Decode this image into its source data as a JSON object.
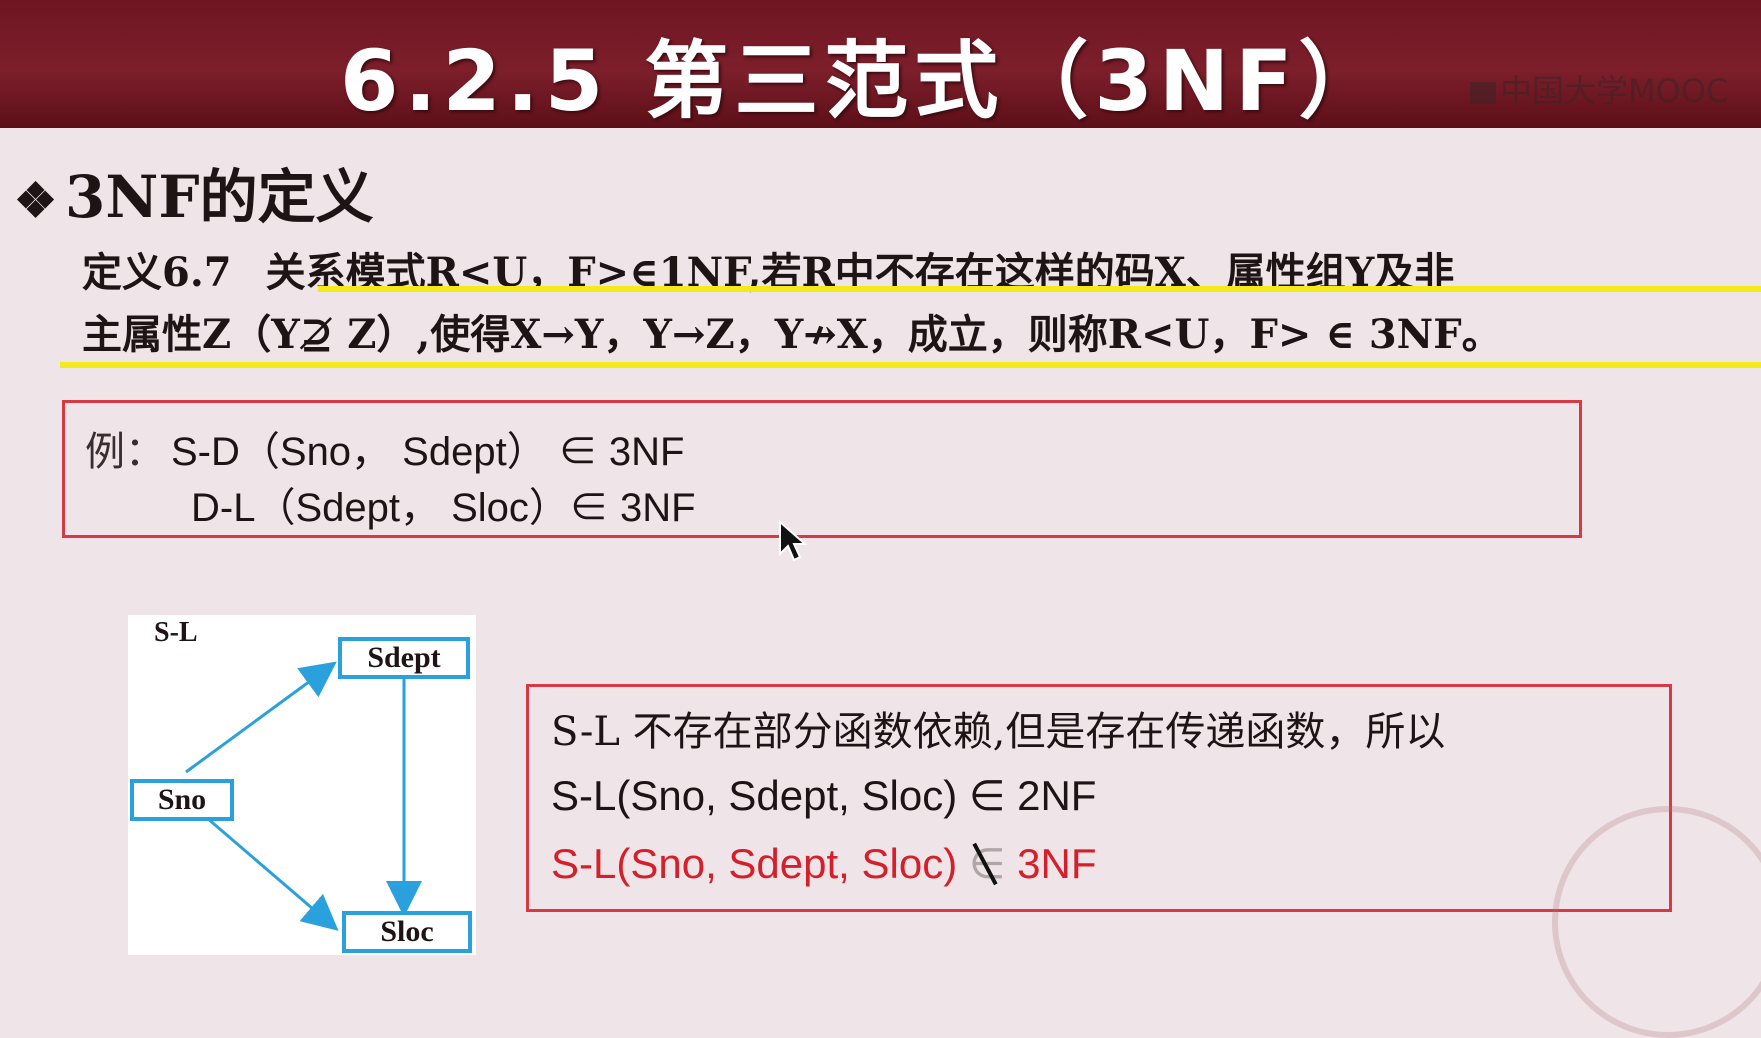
{
  "banner": {
    "title": "6.2.5 第三范式（3NF）",
    "brand": "中国大学MOOC"
  },
  "heading": {
    "bullet": "❖",
    "title": "3NF的定义"
  },
  "definition": {
    "label": "定义6.7",
    "line1": "关系模式R<U，F>∈1NF,若R中不存在这样的码X、属性组Y及非",
    "line2": "主属性Z（Y⊉ Z）,使得X→Y，Y→Z，Y↛X，成立，则称R<U，F> ∈ 3NF。"
  },
  "example": {
    "label": "例：",
    "line1": "S-D（Sno， Sdept） ∈ 3NF",
    "line2": "D-L（Sdept， Sloc）∈ 3NF"
  },
  "diagram": {
    "label": "S-L",
    "nodes": {
      "sno": "Sno",
      "sdept": "Sdept",
      "sloc": "Sloc"
    },
    "edges": [
      {
        "from": "Sno",
        "to": "Sdept"
      },
      {
        "from": "Sno",
        "to": "Sloc"
      },
      {
        "from": "Sdept",
        "to": "Sloc"
      }
    ],
    "edge_color": "#2aa0dc"
  },
  "explanation": {
    "line1": "S-L 不存在部分函数依赖,但是存在传递函数，所以",
    "line2": "S-L(Sno, Sdept, Sloc) ∈ 2NF",
    "line3_prefix": "S-L(Sno, Sdept, Sloc) ",
    "line3_symbol": "∈",
    "line3_suffix": " 3NF"
  },
  "colors": {
    "banner": "#7c1f2b",
    "background": "#efe4e7",
    "box_border": "#d63a45",
    "highlight": "#f3ea1d",
    "red_text": "#d4202b"
  }
}
